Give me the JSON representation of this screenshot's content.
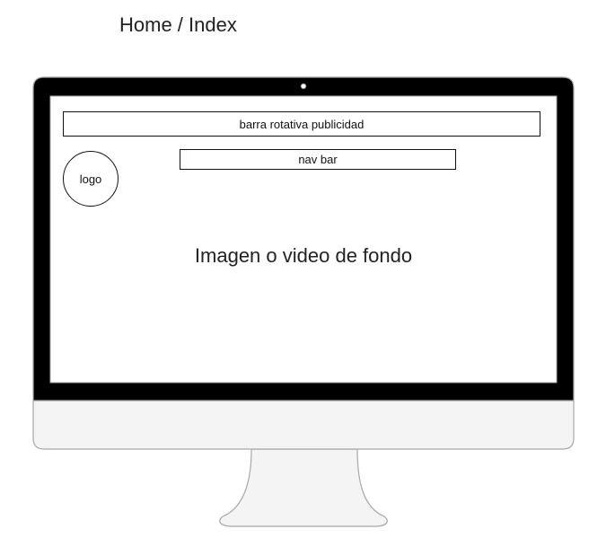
{
  "page": {
    "title": "Home / Index"
  },
  "wireframe": {
    "ad_bar_label": "barra rotativa publicidad",
    "nav_bar_label": "nav bar",
    "logo_label": "logo",
    "background_label": "Imagen o video de fondo"
  },
  "colors": {
    "bezel": "#000000",
    "screen": "#ffffff",
    "chin": "#f4f4f4",
    "stand": "#f4f4f4",
    "outline": "#a8a8a8",
    "camera": "#ffffff"
  }
}
